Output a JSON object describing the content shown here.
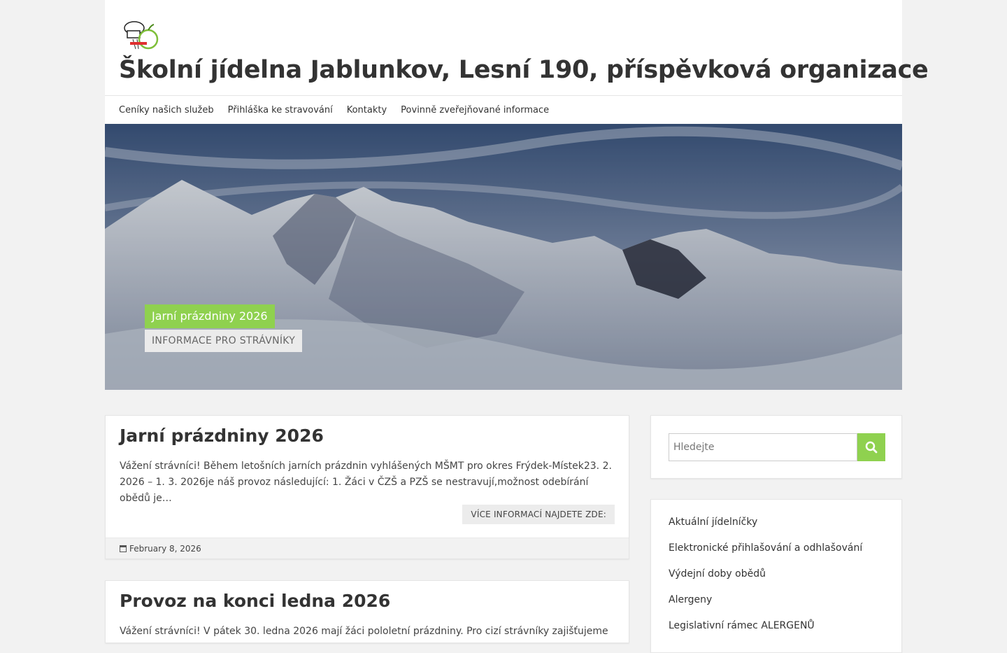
{
  "site": {
    "title": "Školní jídelna Jablunkov, Lesní 190, příspěvková organizace"
  },
  "nav": {
    "items": [
      {
        "label": "Ceníky našich služeb"
      },
      {
        "label": "Přihláška ke stravování"
      },
      {
        "label": "Kontakty"
      },
      {
        "label": "Povinně zveřejňované informace"
      }
    ]
  },
  "hero": {
    "title": "Jarní prázdniny 2026",
    "button": "INFORMACE PRO STRÁVNÍKY"
  },
  "posts": [
    {
      "title": "Jarní prázdniny 2026",
      "excerpt": "Vážení strávníci! Během letošních jarních prázdnin vyhlášených MŠMT  pro okres Frýdek-Místek23. 2. 2026 – 1. 3. 2026je náš provoz následující: 1. Žáci v ČZŠ a PZŠ se nestravují,možnost odebírání obědů je…",
      "more": "VÍCE INFORMACÍ NAJDETE ZDE:",
      "date": "February 8, 2026"
    },
    {
      "title": "Provoz na konci ledna 2026",
      "excerpt": "Vážení strávníci! V pátek 30. ledna 2026 mají žáci pololetní prázdniny. Pro cizí strávníky zajišťujeme"
    }
  ],
  "sidebar": {
    "search_placeholder": "Hledejte",
    "links": [
      {
        "label": "Aktuální jídelníčky"
      },
      {
        "label": "Elektronické přihlašování a odhlašování"
      },
      {
        "label": "Výdejní doby obědů"
      },
      {
        "label": "Alergeny"
      },
      {
        "label": "Legislativní rámec ALERGENŮ"
      }
    ]
  },
  "colors": {
    "accent": "#8fd14f",
    "background": "#f2f2f2"
  }
}
